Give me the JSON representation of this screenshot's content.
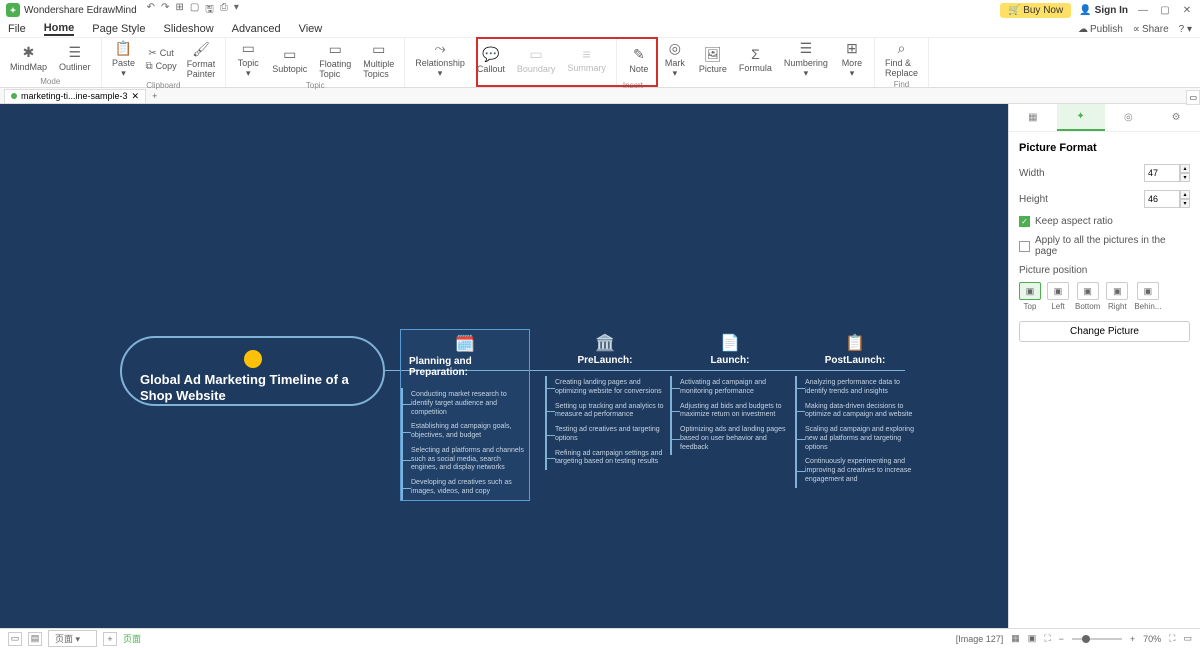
{
  "app": {
    "title": "Wondershare EdrawMind",
    "buynow": "Buy Now",
    "signin": "Sign In"
  },
  "menu": {
    "file": "File",
    "home": "Home",
    "page": "Page Style",
    "slide": "Slideshow",
    "adv": "Advanced",
    "view": "View"
  },
  "ribbon": {
    "mode": {
      "mindmap": "MindMap",
      "outliner": "Outliner",
      "label": "Mode"
    },
    "clip": {
      "paste": "Paste",
      "cut": "Cut",
      "copy": "Copy",
      "painter": "Format\nPainter",
      "label": "Clipboard"
    },
    "topic": {
      "topic": "Topic",
      "subtopic": "Subtopic",
      "floating": "Floating\nTopic",
      "multiple": "Multiple\nTopics",
      "label": "Topic"
    },
    "rel": {
      "relationship": "Relationship",
      "callout": "Callout",
      "boundary": "Boundary",
      "summary": "Summary"
    },
    "insert": {
      "note": "Note",
      "mark": "Mark",
      "picture": "Picture",
      "formula": "Formula",
      "numbering": "Numbering",
      "more": "More",
      "label": "Insert"
    },
    "find": {
      "find": "Find &\nReplace",
      "label": "Find"
    }
  },
  "header": {
    "publish": "Publish",
    "share": "Share"
  },
  "doctab": {
    "name": "marketing-ti...ine-sample-3"
  },
  "map": {
    "root": "Global Ad Marketing Timeline of a Shop Website",
    "b1": {
      "title": "Planning and Preparation:",
      "items": [
        "Conducting market research to identify target audience and competition",
        "Establishing ad campaign goals, objectives, and budget",
        "Selecting ad platforms and channels such as social media, search engines, and display networks",
        "Developing ad creatives such as images, videos, and copy"
      ]
    },
    "b2": {
      "title": "PreLaunch:",
      "items": [
        "Creating landing pages and optimizing website for conversions",
        "Setting up tracking and analytics to measure ad performance",
        "Testing ad creatives and targeting options",
        "Refining ad campaign settings and targeting based on testing results"
      ]
    },
    "b3": {
      "title": "Launch:",
      "items": [
        "Activating ad campaign and monitoring performance",
        "Adjusting ad bids and budgets to maximize return on investment",
        "Optimizing ads and landing pages based on user behavior and feedback"
      ]
    },
    "b4": {
      "title": "PostLaunch:",
      "items": [
        "Analyzing performance data to identify trends and insights",
        "Making data-driven decisions to optimize ad campaign and website",
        "Scaling ad campaign and exploring new ad platforms and targeting options",
        "Continuously experimenting and improving ad creatives to increase engagement and"
      ]
    }
  },
  "panel": {
    "title": "Picture Format",
    "width_l": "Width",
    "width_v": "47",
    "height_l": "Height",
    "height_v": "46",
    "keep": "Keep aspect ratio",
    "apply": "Apply to all the pictures in the page",
    "pos_l": "Picture position",
    "top": "Top",
    "left": "Left",
    "bottom": "Bottom",
    "right": "Right",
    "behind": "Behin...",
    "change": "Change Picture"
  },
  "status": {
    "page": "页面",
    "img": "[Image 127]",
    "zoom": "70%"
  }
}
